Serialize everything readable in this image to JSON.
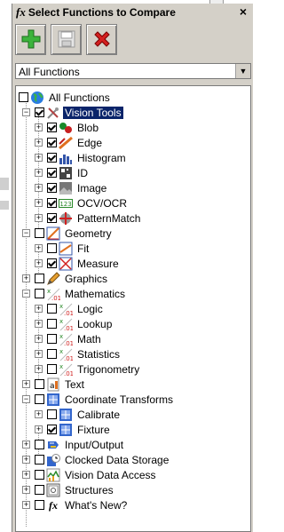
{
  "window": {
    "title": "Select Functions to Compare",
    "fx_symbol": "fx",
    "close": "×"
  },
  "toolbar": {
    "add": "add-button",
    "save": "save-button",
    "delete": "delete-button"
  },
  "filter": {
    "selected": "All Functions"
  },
  "tree": {
    "root": "All Functions",
    "vision_tools": "Vision Tools",
    "blob": "Blob",
    "edge": "Edge",
    "histogram": "Histogram",
    "id": "ID",
    "image": "Image",
    "ocv": "OCV/OCR",
    "patmax": "PatternMatch",
    "geometry": "Geometry",
    "fit": "Fit",
    "measure": "Measure",
    "graphics": "Graphics",
    "mathematics": "Mathematics",
    "logic": "Logic",
    "lookup": "Lookup",
    "math": "Math",
    "statistics": "Statistics",
    "trig": "Trigonometry",
    "text": "Text",
    "coord": "Coordinate Transforms",
    "calibrate": "Calibrate",
    "fixture": "Fixture",
    "io": "Input/Output",
    "clocked": "Clocked Data Storage",
    "vda": "Vision Data Access",
    "structures": "Structures",
    "whatsnew": "What's New?"
  },
  "colors": {
    "selection": "#0a246a",
    "panel": "#d4d0c8"
  }
}
